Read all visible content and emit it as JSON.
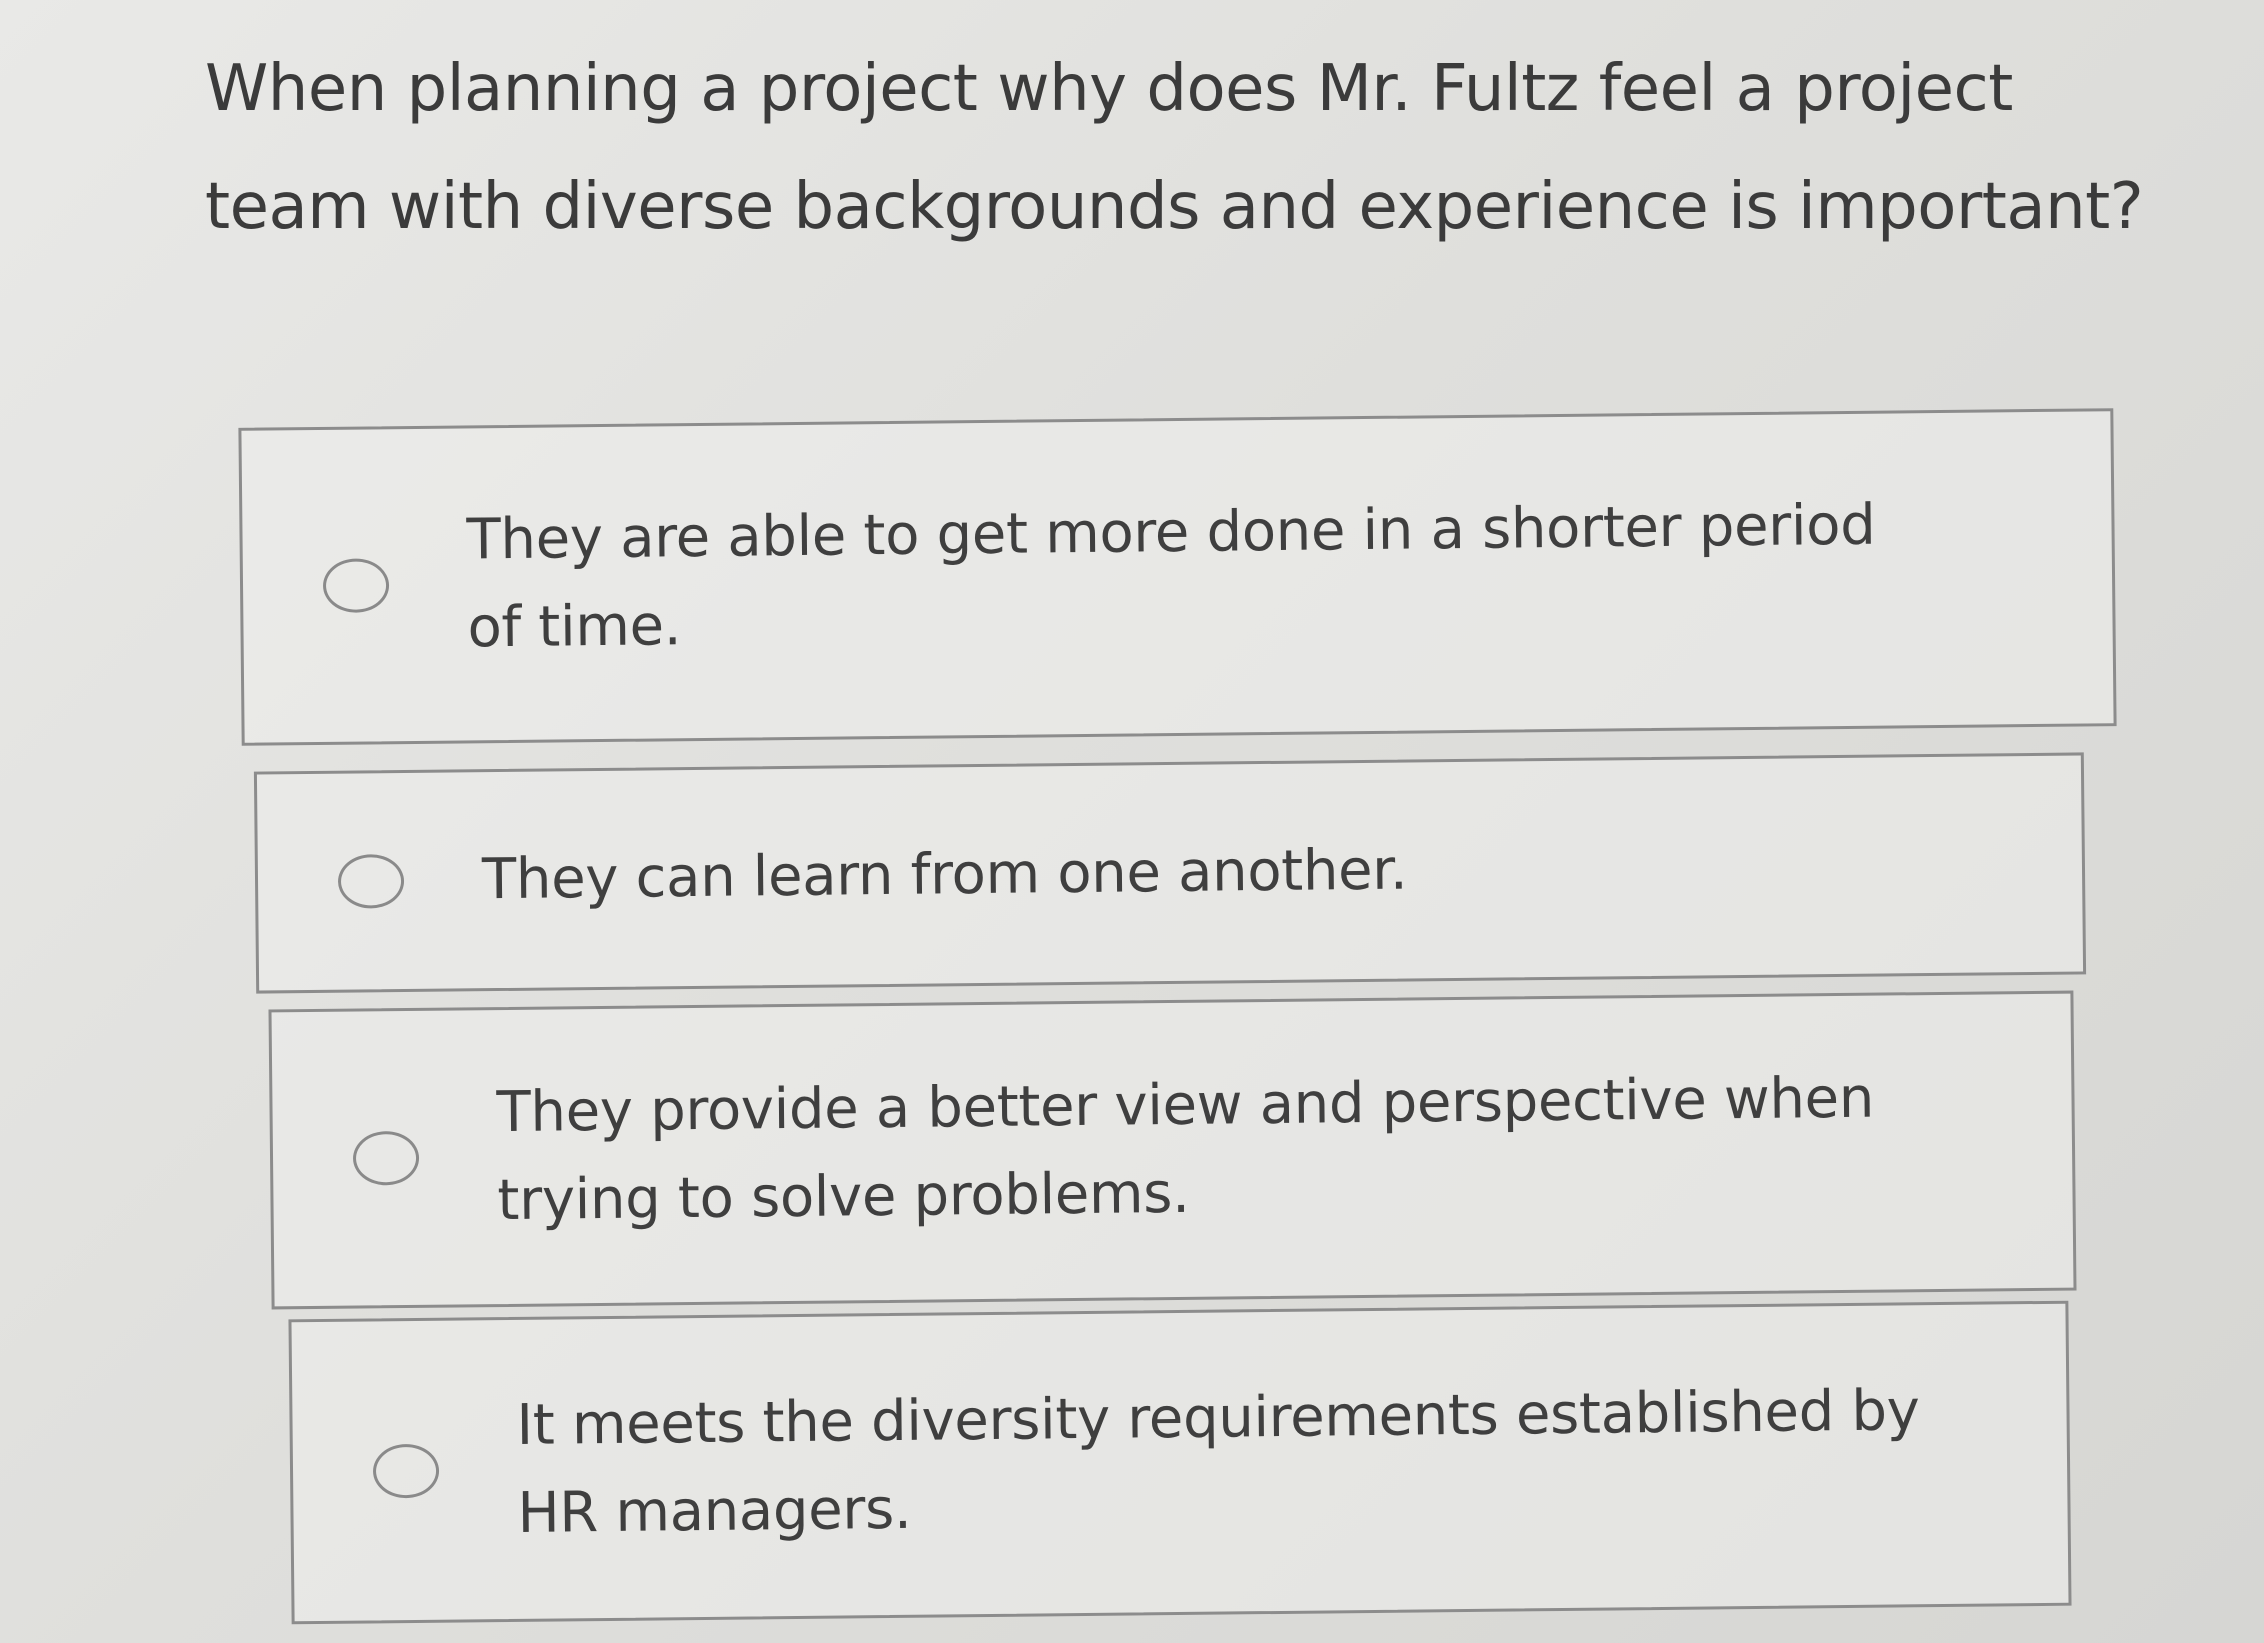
{
  "quiz": {
    "question": "When planning a project why does Mr. Fultz feel a project team with diverse backgrounds and experience is important?",
    "options": [
      {
        "label": "They are able to get more done in a shorter period of time."
      },
      {
        "label": "They can learn from one another."
      },
      {
        "label": "They provide a better view and perspective when trying to solve problems."
      },
      {
        "label": "It meets the diversity requirements established by HR managers."
      }
    ]
  }
}
